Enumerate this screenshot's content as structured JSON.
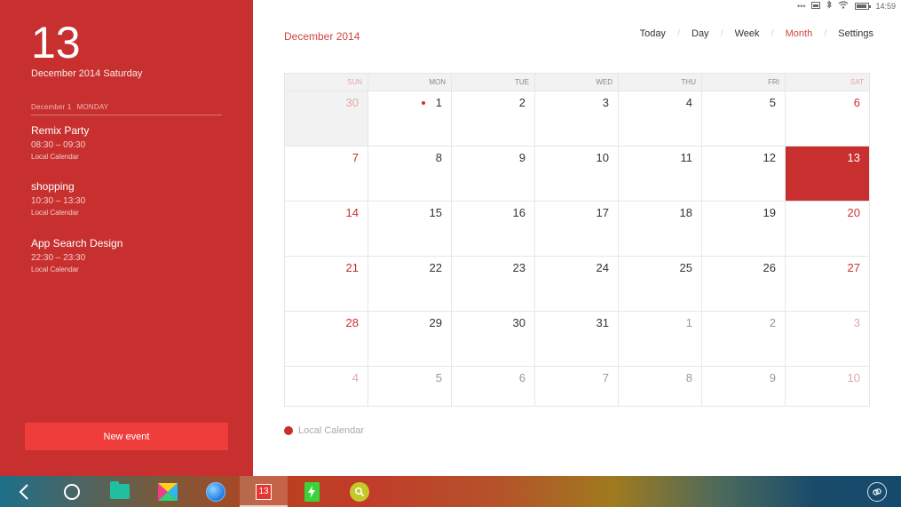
{
  "status_bar": {
    "dots": "•••",
    "time": "14:59",
    "icons": [
      "cast-icon",
      "bluetooth-icon",
      "wifi-icon",
      "battery-icon"
    ]
  },
  "sidebar": {
    "big_day": "13",
    "full_date": "December 2014 Saturday",
    "agenda_date": "December 1",
    "agenda_weekday": "MONDAY",
    "events": [
      {
        "title": "Remix Party",
        "time": "08:30 – 09:30",
        "calendar": "Local Calendar"
      },
      {
        "title": "shopping",
        "time": "10:30 – 13:30",
        "calendar": "Local Calendar"
      },
      {
        "title": "App Search Design",
        "time": "22:30 – 23:30",
        "calendar": "Local Calendar"
      }
    ],
    "new_event_label": "New event"
  },
  "header": {
    "month_title": "December 2014",
    "nav": [
      {
        "label": "Today",
        "active": false
      },
      {
        "label": "Day",
        "active": false
      },
      {
        "label": "Week",
        "active": false
      },
      {
        "label": "Month",
        "active": true
      },
      {
        "label": "Settings",
        "active": false
      }
    ]
  },
  "calendar": {
    "weekdays": [
      "SUN",
      "MON",
      "TUE",
      "WED",
      "THU",
      "FRI",
      "SAT"
    ],
    "weeks": [
      [
        "30",
        "1",
        "2",
        "3",
        "4",
        "5",
        "6"
      ],
      [
        "7",
        "8",
        "9",
        "10",
        "11",
        "12",
        "13"
      ],
      [
        "14",
        "15",
        "16",
        "17",
        "18",
        "19",
        "20"
      ],
      [
        "21",
        "22",
        "23",
        "24",
        "25",
        "26",
        "27"
      ],
      [
        "28",
        "29",
        "30",
        "31",
        "1",
        "2",
        "3"
      ],
      [
        "4",
        "5",
        "6",
        "7",
        "8",
        "9",
        "10"
      ]
    ],
    "today": "13",
    "event_days": [
      "1"
    ]
  },
  "legend": {
    "label": "Local Calendar"
  },
  "taskbar": {
    "calendar_badge": "13",
    "apps": [
      "back-icon",
      "home-icon",
      "files-app-icon",
      "store-app-icon",
      "browser-app-icon",
      "calendar-app-icon",
      "power-app-icon",
      "search-app-icon"
    ]
  },
  "colors": {
    "accent": "#c8302f",
    "button": "#ef3d3c",
    "muted_weekend": "#e5a7a6"
  }
}
